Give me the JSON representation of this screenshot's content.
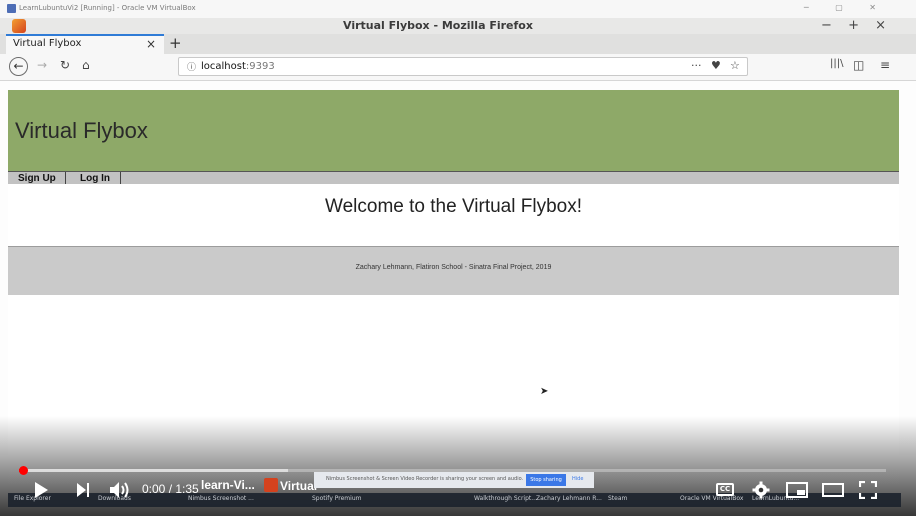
{
  "vbox": {
    "title": "LearnLubuntuVi2 [Running] - Oracle VM VirtualBox",
    "controls": "─ ▢ ✕"
  },
  "firefox": {
    "window_title": "Virtual Flybox - Mozilla Firefox",
    "window_controls": "− + ×",
    "tab": {
      "label": "Virtual Flybox",
      "close": "×"
    },
    "new_tab": "+",
    "url": {
      "info": "ⓘ",
      "host": "localhost",
      "port": ":9393"
    },
    "url_right": {
      "more": "···",
      "pocket": "♥",
      "star": "☆"
    },
    "toolbar_right": {
      "library": "|||\\",
      "sidebar": "◫",
      "menu": "≡"
    },
    "nav": {
      "back": "←",
      "forward": "→",
      "reload": "↻",
      "home": "⌂"
    }
  },
  "site": {
    "title": "Virtual Flybox",
    "menu": [
      "Sign Up",
      "Log In"
    ],
    "welcome": "Welcome to the Virtual Flybox!",
    "footer": "Zachary Lehmann, Flatiron School - Sinatra Final Project, 2019"
  },
  "player": {
    "time": "0:00 / 1:35",
    "progress_fraction": 0.002,
    "buffered_fraction": 0.31,
    "cc_label": "CC",
    "share_message": "Nimbus Screenshot & Screen Video Recorder is sharing your screen and audio.",
    "stop_sharing": "Stop sharing",
    "hide": "Hide",
    "taskbar_items": [
      "File Explorer",
      "Downloads",
      "Nimbus Screenshot ...",
      "learn-Vi...",
      "Virtual",
      "Spotify Premium",
      "Walkthrough Script...",
      "Zachary Lehmann R...",
      "Steam",
      "Oracle VM VirtualBox",
      "LearnLubuntu..."
    ]
  },
  "colors": {
    "banner": "#8ea968",
    "progress": "#ff0000",
    "tab_accent": "#2f7bd6"
  }
}
